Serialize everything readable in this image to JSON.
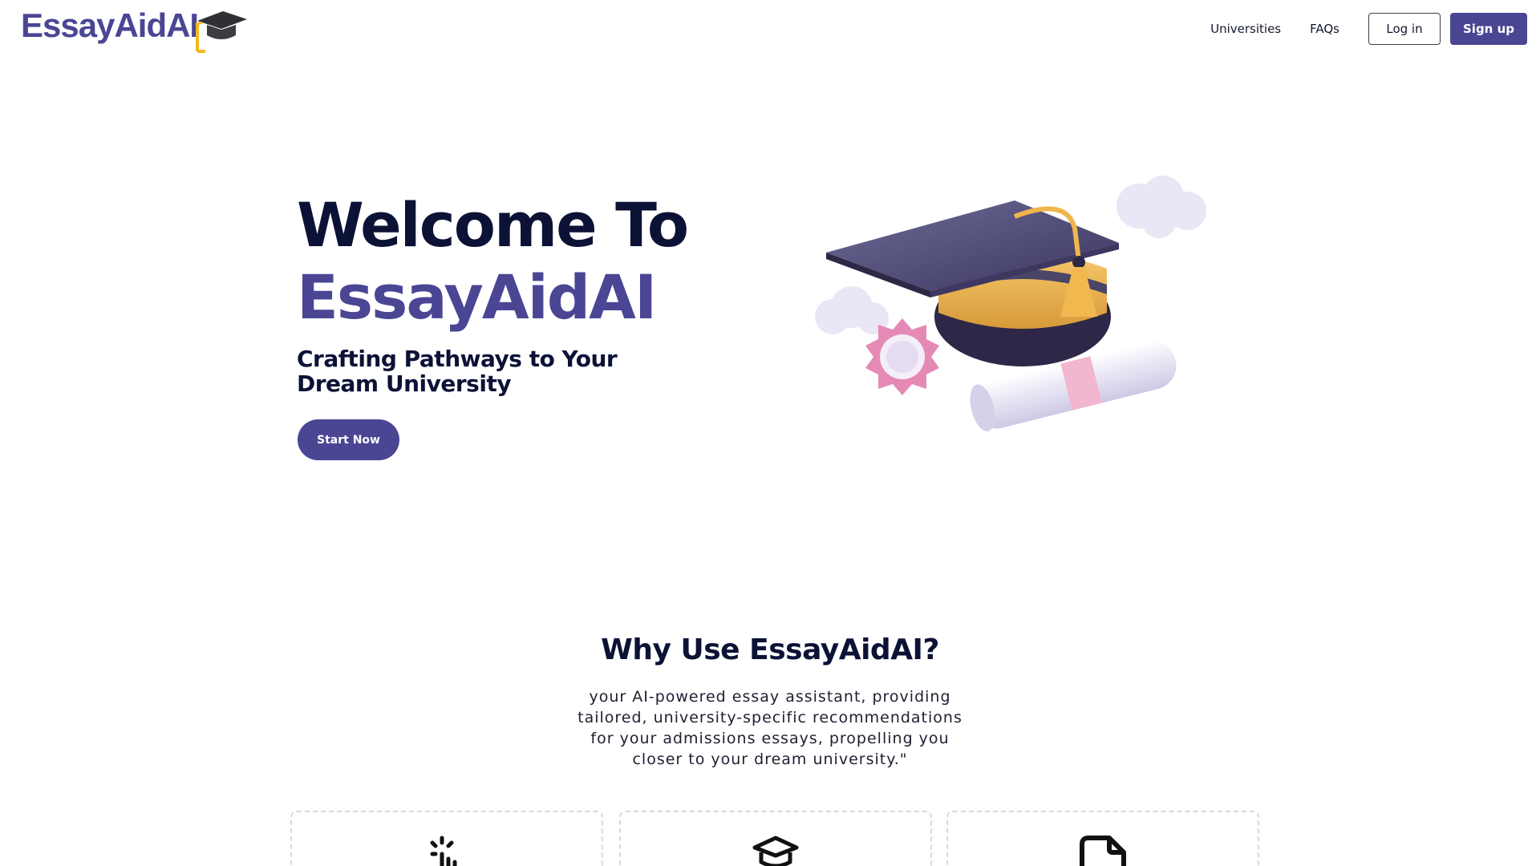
{
  "header": {
    "logo_text": "EssayAidAI",
    "logo_icon": "graduation-cap-icon",
    "nav": [
      "Universities",
      "FAQs"
    ],
    "login_label": "Log in",
    "signup_label": "Sign up"
  },
  "hero": {
    "title_line1": "Welcome To",
    "title_line2": "EssayAidAI",
    "subtitle": "Crafting Pathways to Your Dream University",
    "cta_label": "Start Now",
    "illustration": "graduation-cap-diploma-illustration"
  },
  "why": {
    "title": "Why Use EssayAidAI?",
    "description": "your AI-powered essay assistant, providing tailored, university-specific recommendations for your admissions essays, propelling you closer to your dream university.\"",
    "cards": [
      {
        "icon": "click-pointer-icon"
      },
      {
        "icon": "university-building-icon"
      },
      {
        "icon": "document-icon"
      }
    ]
  },
  "colors": {
    "brand": "#4a4694",
    "dark": "#0c1236",
    "card_border": "#d8d8de"
  }
}
